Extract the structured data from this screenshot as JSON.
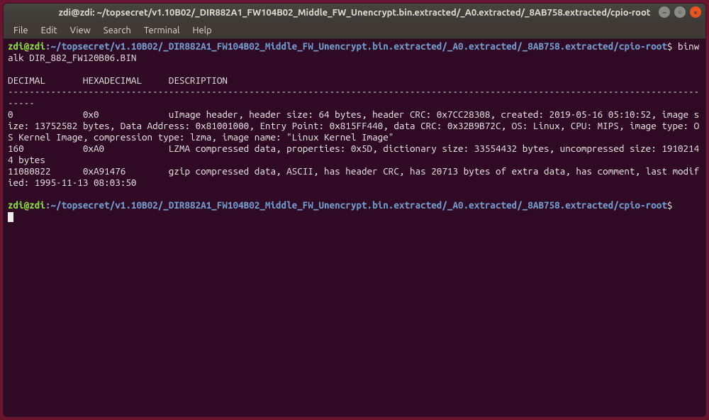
{
  "window": {
    "title": "zdi@zdi: ~/topsecret/v1.10B02/_DIR882A1_FW104B02_Middle_FW_Unencrypt.bin.extracted/_A0.extracted/_8AB758.extracted/cpio-root"
  },
  "menu": {
    "file": "File",
    "edit": "Edit",
    "view": "View",
    "search": "Search",
    "terminal": "Terminal",
    "help": "Help"
  },
  "prompt": {
    "userhost": "zdi@zdi",
    "colon": ":",
    "path": "~/topsecret/v1.10B02/_DIR882A1_FW104B02_Middle_FW_Unencrypt.bin.extracted/_A0.extracted/_8AB758.extracted/cpio-root",
    "dollar": "$"
  },
  "command": "binwalk DIR_882_FW120B06.BIN",
  "output": {
    "blank1": "",
    "header": "DECIMAL       HEXADECIMAL     DESCRIPTION",
    "divider": "--------------------------------------------------------------------------------------------------------------------------------------",
    "row1": "0             0x0             uImage header, header size: 64 bytes, header CRC: 0x7CC28308, created: 2019-05-16 05:10:52, image size: 13752582 bytes, Data Address: 0x81001000, Entry Point: 0x815FF440, data CRC: 0x32B9B72C, OS: Linux, CPU: MIPS, image type: OS Kernel Image, compression type: lzma, image name: \"Linux Kernel Image\"",
    "row2": "160           0xA0            LZMA compressed data, properties: 0x5D, dictionary size: 33554432 bytes, uncompressed size: 19102144 bytes",
    "row3": "11080822      0xA91476        gzip compressed data, ASCII, has header CRC, has 20713 bytes of extra data, has comment, last modified: 1995-11-13 08:03:50",
    "blank2": ""
  }
}
